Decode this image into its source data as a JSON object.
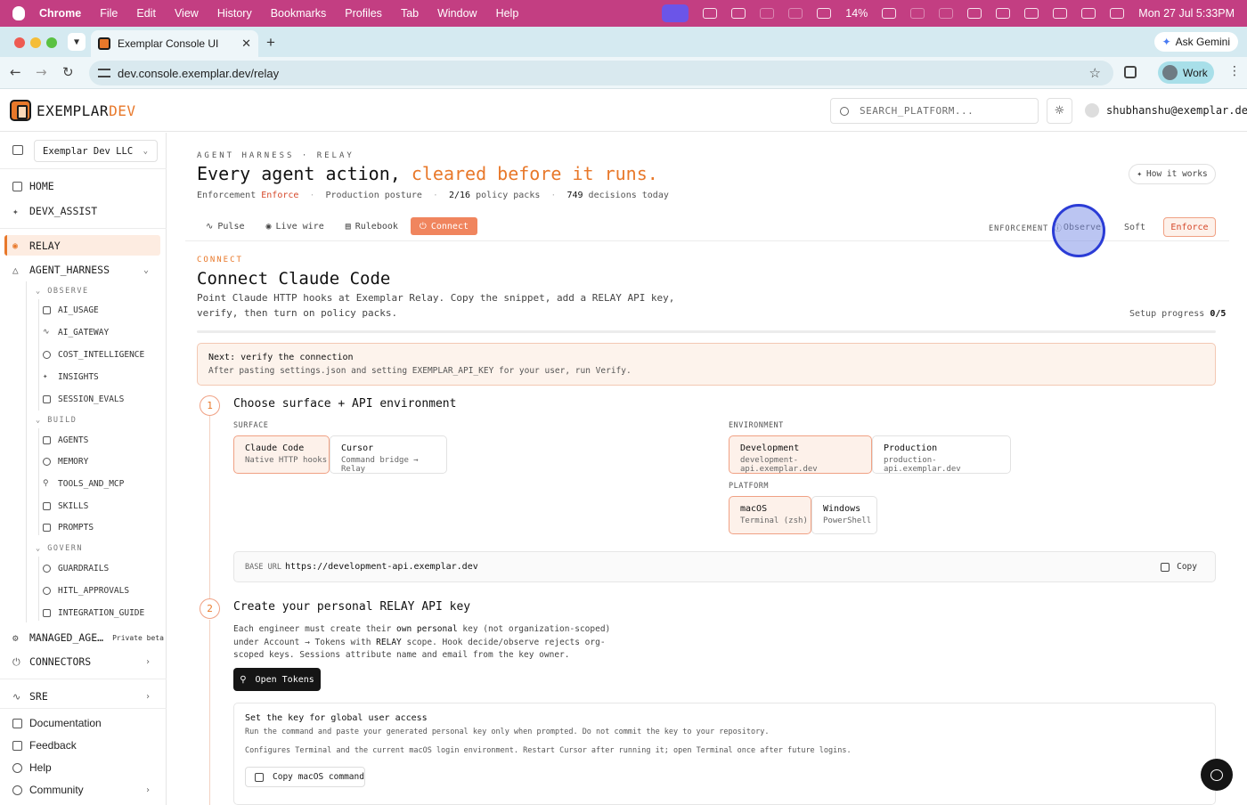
{
  "menubar": {
    "app": "Chrome",
    "items": [
      "File",
      "Edit",
      "View",
      "History",
      "Bookmarks",
      "Profiles",
      "Tab",
      "Window",
      "Help"
    ],
    "battery": "14%",
    "datetime": "Mon 27 Jul  5:33PM"
  },
  "browser": {
    "tab_title": "Exemplar Console UI",
    "url": "dev.console.exemplar.dev/relay",
    "ask_gemini": "Ask Gemini",
    "profile": "Work"
  },
  "header": {
    "brand_a": "EXEMPLAR",
    "brand_b": "DEV",
    "search_placeholder": "SEARCH_PLATFORM...",
    "user_email": "shubhanshu@exemplar.dev"
  },
  "sidebar": {
    "org": "Exemplar Dev LLC",
    "home": "HOME",
    "devx": "DEVX_ASSIST",
    "relay": "RELAY",
    "agent_harness": "AGENT_HARNESS",
    "observe": "OBSERVE",
    "ai_usage": "AI_USAGE",
    "ai_gateway": "AI_GATEWAY",
    "cost": "COST_INTELLIGENCE",
    "insights": "INSIGHTS",
    "session_evals": "SESSION_EVALS",
    "build": "BUILD",
    "agents": "AGENTS",
    "memory": "MEMORY",
    "tools": "TOOLS_AND_MCP",
    "skills": "SKILLS",
    "prompts": "PROMPTS",
    "govern": "GOVERN",
    "guardrails": "GUARDRAILS",
    "hitl": "HITL_APPROVALS",
    "integration": "INTEGRATION_GUIDE",
    "managed": "MANAGED_AGE…",
    "private_beta": "Private beta",
    "connectors": "CONNECTORS",
    "sre": "SRE",
    "documentation": "Documentation",
    "feedback": "Feedback",
    "help": "Help",
    "community": "Community"
  },
  "page": {
    "eyebrow": "AGENT HARNESS · RELAY",
    "title_a": "Every agent action, ",
    "title_b": "cleared before it runs.",
    "meta_enf_label": "Enforcement",
    "meta_enf_value": "Enforce",
    "meta_posture": "Production posture",
    "meta_packs_count": "2/16",
    "meta_packs_label": "policy packs",
    "meta_decisions_count": "749",
    "meta_decisions_label": "decisions today",
    "how_it_works": "How it works",
    "tabs": [
      "Pulse",
      "Live wire",
      "Rulebook",
      "Connect"
    ],
    "enforcement_label": "ENFORCEMENT",
    "modes": [
      "Observe",
      "Soft",
      "Enforce"
    ]
  },
  "connect": {
    "eyebrow": "CONNECT",
    "title": "Connect Claude Code",
    "desc": "Point Claude HTTP hooks at Exemplar Relay. Copy the snippet, add a RELAY API key, verify, then turn on policy packs.",
    "progress_label": "Setup progress",
    "progress_value": "0/5",
    "progress_fraction": 0,
    "notice_title": "Next: verify the connection",
    "notice_body": "After pasting settings.json and setting EXEMPLAR_API_KEY for your user, run Verify."
  },
  "step1": {
    "number": "1",
    "title": "Choose surface + API environment",
    "surface_label": "SURFACE",
    "surfaces": [
      {
        "name": "Claude Code",
        "sub": "Native HTTP hooks"
      },
      {
        "name": "Cursor",
        "sub": "Command bridge → Relay"
      }
    ],
    "environment_label": "ENVIRONMENT",
    "environments": [
      {
        "name": "Development",
        "sub": "development-api.exemplar.dev"
      },
      {
        "name": "Production",
        "sub": "production-api.exemplar.dev"
      }
    ],
    "platform_label": "PLATFORM",
    "platforms": [
      {
        "name": "macOS",
        "sub": "Terminal (zsh)"
      },
      {
        "name": "Windows",
        "sub": "PowerShell"
      }
    ],
    "base_url_label": "BASE URL",
    "base_url": "https://development-api.exemplar.dev",
    "copy": "Copy"
  },
  "step2": {
    "number": "2",
    "title": "Create your personal RELAY API key",
    "p1": "Each engineer must create their ",
    "p_bold1": "own personal",
    "p2": " key (not organization-scoped) under Account → Tokens with ",
    "p_bold2": "RELAY",
    "p3": " scope. Hook decide/observe rejects org-scoped keys. Sessions attribute name and email from the key owner.",
    "open_tokens": "Open Tokens",
    "key_title": "Set the key for global user access",
    "key_line1": "Run the command and paste your generated personal key only when prompted. Do not commit the key to your repository.",
    "key_line2": "Configures Terminal and the current macOS login environment. Restart Cursor after running it; open Terminal once after future logins.",
    "copy_cmd": "Copy macOS command"
  },
  "colors": {
    "accent": "#e8782a",
    "menubar": "#c33e82",
    "danger": "#d6492b"
  }
}
